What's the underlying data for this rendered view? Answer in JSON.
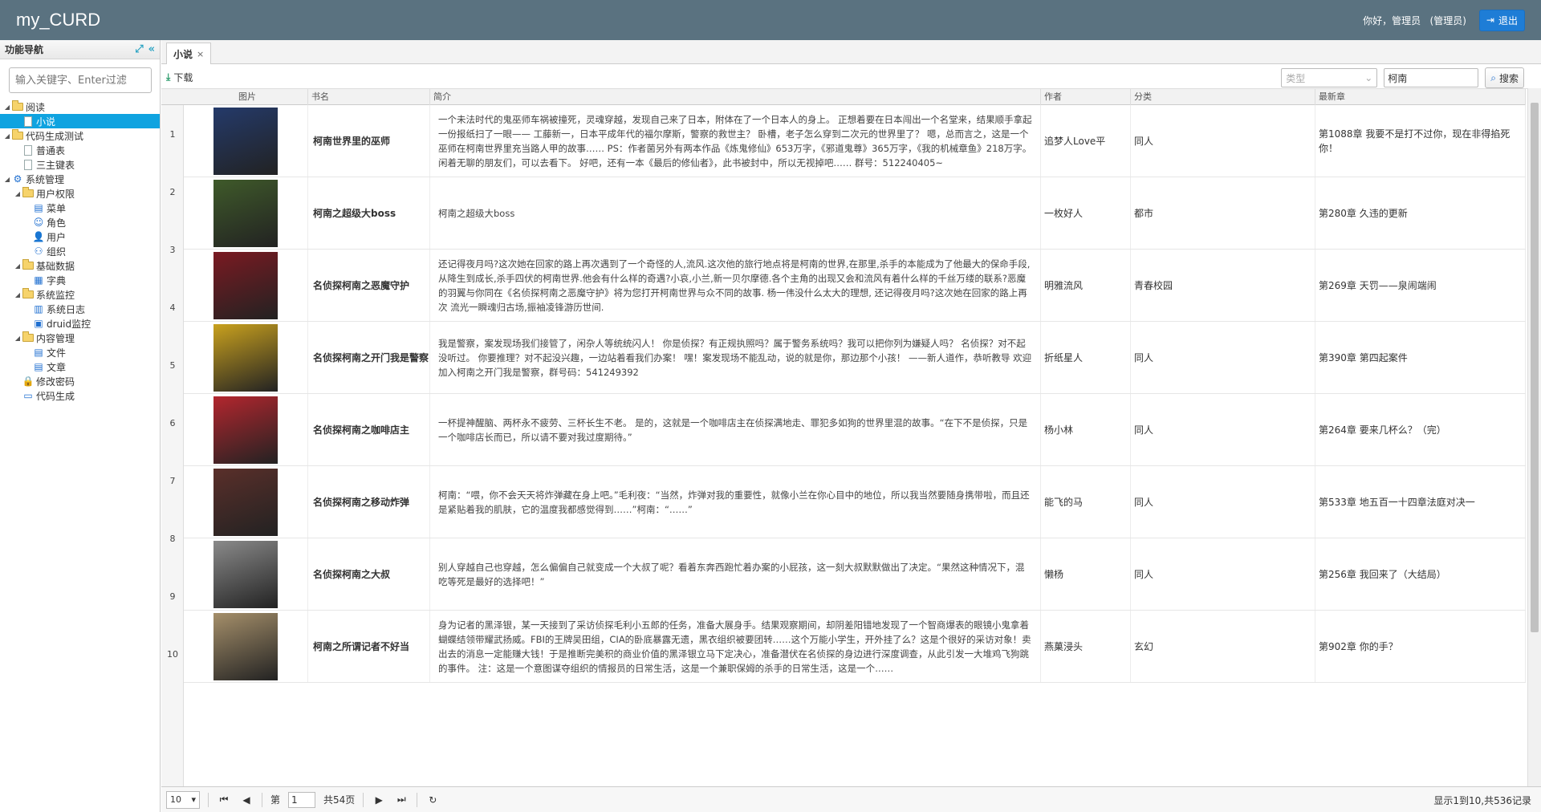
{
  "app": {
    "title": "my_CURD",
    "greeting": "你好，管理员",
    "role": "(管理员)",
    "logout_label": "退出"
  },
  "sidebar": {
    "title": "功能导航",
    "filter_placeholder": "输入关键字、Enter过滤",
    "tree": [
      {
        "label": "阅读",
        "level": 0,
        "type": "folder",
        "expanded": true
      },
      {
        "label": "小说",
        "level": 1,
        "type": "doc",
        "selected": true
      },
      {
        "label": "代码生成测试",
        "level": 0,
        "type": "folder",
        "expanded": true
      },
      {
        "label": "普通表",
        "level": 1,
        "type": "doc"
      },
      {
        "label": "三主键表",
        "level": 1,
        "type": "doc"
      },
      {
        "label": "系统管理",
        "level": 0,
        "type": "gear-icon",
        "expanded": true
      },
      {
        "label": "用户权限",
        "level": 1,
        "type": "folder",
        "expanded": true
      },
      {
        "label": "菜单",
        "level": 2,
        "type": "menu-icon"
      },
      {
        "label": "角色",
        "level": 2,
        "type": "role-icon"
      },
      {
        "label": "用户",
        "level": 2,
        "type": "user-icon"
      },
      {
        "label": "组织",
        "level": 2,
        "type": "org-icon"
      },
      {
        "label": "基础数据",
        "level": 1,
        "type": "folder",
        "expanded": true
      },
      {
        "label": "字典",
        "level": 2,
        "type": "dict-icon"
      },
      {
        "label": "系统监控",
        "level": 1,
        "type": "folder",
        "expanded": true
      },
      {
        "label": "系统日志",
        "level": 2,
        "type": "log-icon"
      },
      {
        "label": "druid监控",
        "level": 2,
        "type": "monitor-icon"
      },
      {
        "label": "内容管理",
        "level": 1,
        "type": "folder",
        "expanded": true
      },
      {
        "label": "文件",
        "level": 2,
        "type": "file-icon"
      },
      {
        "label": "文章",
        "level": 2,
        "type": "article-icon"
      },
      {
        "label": "修改密码",
        "level": 1,
        "type": "lock-icon"
      },
      {
        "label": "代码生成",
        "level": 1,
        "type": "code-icon"
      }
    ]
  },
  "tab": {
    "label": "小说",
    "close": "×"
  },
  "toolbar": {
    "download_label": "下载",
    "type_placeholder": "类型",
    "keyword_value": "柯南",
    "search_label": "搜索"
  },
  "grid": {
    "columns": [
      "图片",
      "书名",
      "简介",
      "作者",
      "分类",
      "最新章"
    ],
    "rownums": [
      "1",
      "2",
      "3",
      "4",
      "5",
      "6",
      "7",
      "8",
      "9",
      "10"
    ],
    "rows": [
      {
        "cover_color": "#243a6a",
        "name": "柯南世界里的巫师",
        "intro": "一个未法时代的鬼巫师车祸被撞死，灵魂穿越，发现自己来了日本，附体在了一个日本人的身上。 正想着要在日本闯出一个名堂来，结果顺手拿起一份报纸扫了一眼—— 工藤新一，日本平成年代的福尔摩斯，警察的救世主？ 卧槽，老子怎么穿到二次元的世界里了？ 嗯，总而言之，这是一个巫师在柯南世界里充当路人甲的故事…… PS：作者菌另外有两本作品《炼鬼修仙》653万字，《邪道鬼尊》365万字，《我的机械章鱼》218万字。闲着无聊的朋友们，可以去看下。 好吧，还有一本《最后的修仙者》，此书被封中，所以无视掉吧…… 群号：512240405~",
        "author": "追梦人Love平",
        "category": "同人",
        "latest": "第1088章 我要不是打不过你，现在非得掐死你！"
      },
      {
        "cover_color": "#3f5a2a",
        "name": "柯南之超级大boss",
        "intro": "柯南之超级大boss",
        "author": "一枚好人",
        "category": "都市",
        "latest": "第280章 久违的更新"
      },
      {
        "cover_color": "#7a1a22",
        "name": "名侦探柯南之恶魔守护",
        "intro": "还记得夜月吗?这次她在回家的路上再次遇到了一个奇怪的人,流风.这次他的旅行地点将是柯南的世界,在那里,杀手的本能成为了他最大的保命手段,从降生到成长,杀手四伏的柯南世界.他会有什么样的奇遇?小哀,小兰,新一贝尔摩德.各个主角的出现又会和流风有着什么样的千丝万缕的联系?恶魔的羽翼与你同在《名侦探柯南之恶魔守护》将为您打开柯南世界与众不同的故事. 杨一伟没什么太大的理想, 还记得夜月吗?这次她在回家的路上再次 流光一瞬魂归古场,振袖凌锋游历世间.",
        "author": "明雅流风",
        "category": "青春校园",
        "latest": "第269章 天罚——泉闹端闹"
      },
      {
        "cover_color": "#c9a11e",
        "name": "名侦探柯南之开门我是警察",
        "intro": "我是警察，案发现场我们接管了，闲杂人等统统闪人！ 你是侦探？有正规执照吗？属于警务系统吗？我可以把你列为嫌疑人吗？ 名侦探？对不起没听过。 你要推理？对不起没兴趣，一边站着看我们办案！ 嘿！案发现场不能乱动，说的就是你，那边那个小孩！ ——新人道作，恭听教导 欢迎加入柯南之开门我是警察，群号码：541249392",
        "author": "折纸星人",
        "category": "同人",
        "latest": "第390章 第四起案件"
      },
      {
        "cover_color": "#b3262e",
        "name": "名侦探柯南之咖啡店主",
        "intro": "一杯提神醒脑、两杯永不疲劳、三杯长生不老。 是的，这就是一个咖啡店主在侦探满地走、罪犯多如狗的世界里混的故事。“在下不是侦探，只是一个咖啡店长而已，所以请不要对我过度期待。”",
        "author": "杨小林",
        "category": "同人",
        "latest": "第264章 要来几杯么？（完）"
      },
      {
        "cover_color": "#5a2f2a",
        "name": "名侦探柯南之移动炸弹",
        "intro": "柯南：“喂，你不会天天将炸弹藏在身上吧。”毛利夜：“当然，炸弹对我的重要性，就像小兰在你心目中的地位，所以我当然要随身携带啦，而且还是紧贴着我的肌肤，它的温度我都感觉得到……”柯南：“……”",
        "author": "能飞的马",
        "category": "同人",
        "latest": "第533章 地五百一十四章法庭对决一"
      },
      {
        "cover_color": "#8a8a8a",
        "name": "名侦探柯南之大叔",
        "intro": "别人穿越自己也穿越，怎么偏偏自己就变成一个大叔了呢？看着东奔西跑忙着办案的小屁孩，这一刻大叔默默做出了决定。“果然这种情况下，混吃等死是最好的选择吧！”",
        "author": "懒杨",
        "category": "同人",
        "latest": "第256章 我回来了（大结局）"
      },
      {
        "cover_color": "#a58f6a",
        "name": "柯南之所谓记者不好当",
        "intro": "身为记者的黑泽银，某一天接到了采访侦探毛利小五郎的任务，准备大展身手。结果观察期间，却阴差阳错地发现了一个智商爆表的眼镜小鬼拿着蝴蝶结领带耀武扬威。FBI的王牌吴田组，CIA的卧底暴露无遗，黑衣组织被要团转……这个万能小学生，开外挂了么？这是个很好的采访对象！卖出去的消息一定能赚大钱！于是推断完美积的商业价值的黑泽银立马下定决心，准备潜伏在名侦探的身边进行深度调查，从此引发一大堆鸡飞狗跳的事件。 注：这是一个意图谋夺组织的情报员的日常生活，这是一个兼职保姆的杀手的日常生活，这是一个……",
        "author": "燕菓浸头",
        "category": "玄幻",
        "latest": "第902章 你的手？"
      }
    ]
  },
  "pager": {
    "page_size": "10",
    "page_prefix": "第",
    "page_value": "1",
    "page_suffix": "共54页",
    "info": "显示1到10,共536记录"
  }
}
